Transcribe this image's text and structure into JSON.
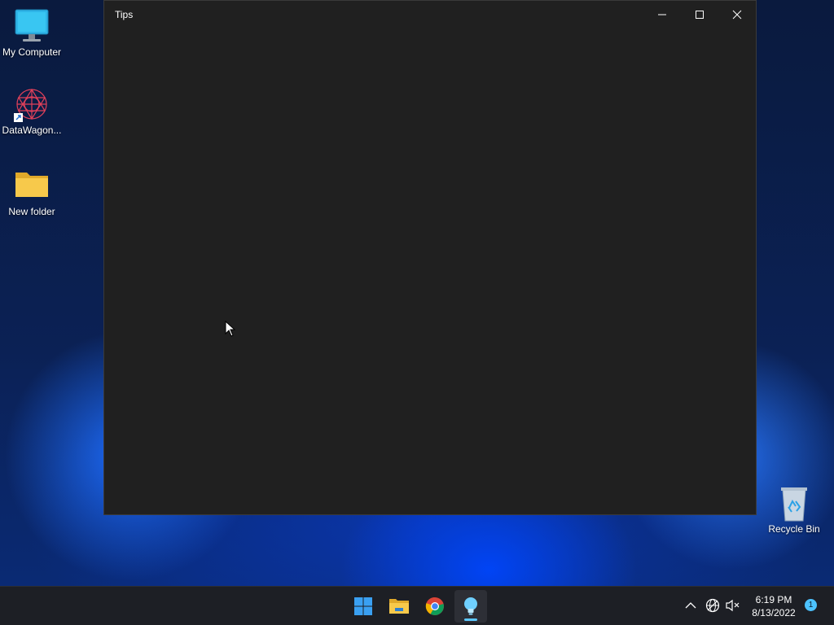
{
  "desktop": {
    "icons": [
      {
        "label": "My Computer"
      },
      {
        "label": "DataWagon..."
      },
      {
        "label": "New folder"
      },
      {
        "label": "Recycle Bin"
      }
    ]
  },
  "window": {
    "title": "Tips",
    "controls": {
      "minimize": "minimize-icon",
      "maximize": "maximize-icon",
      "close": "close-icon"
    }
  },
  "taskbar": {
    "apps": [
      {
        "name": "Start",
        "icon": "windows-logo-icon"
      },
      {
        "name": "File Explorer",
        "icon": "folder-icon"
      },
      {
        "name": "Google Chrome",
        "icon": "chrome-icon"
      },
      {
        "name": "Tips",
        "icon": "lightbulb-icon",
        "active": true
      }
    ],
    "tray": {
      "icons": [
        "chevron-up-icon",
        "network-icon",
        "volume-muted-icon"
      ],
      "time": "6:19 PM",
      "date": "8/13/2022",
      "notifications": "1"
    }
  },
  "colors": {
    "accent": "#4cc2ff",
    "window_bg": "#202020",
    "taskbar_bg": "#1d1f25"
  }
}
